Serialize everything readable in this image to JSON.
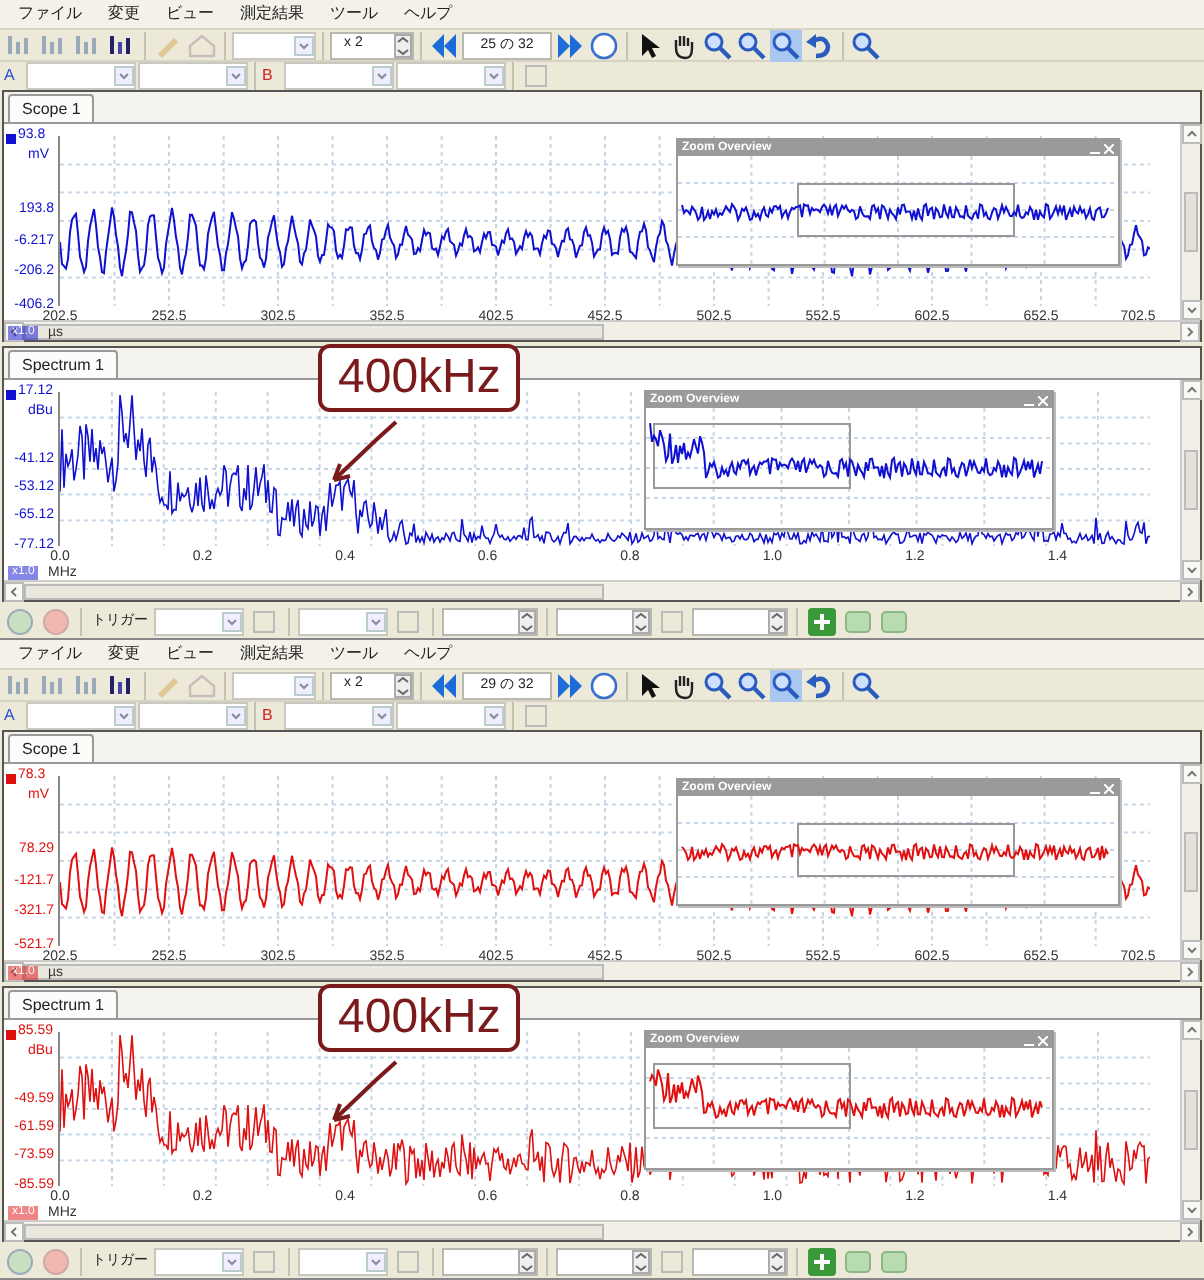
{
  "windows": [
    {
      "color": "#1010d0",
      "menu": [
        "ファイル",
        "変更",
        "ビュー",
        "測定結果",
        "ツール",
        "ヘルプ"
      ],
      "zoom_factor": "x 2",
      "page": "25 の 32",
      "channel_a": "A",
      "channel_b": "B",
      "scope": {
        "tab": "Scope 1",
        "y_labels": [
          "93.8",
          "193.8",
          "-6.217",
          "-206.2",
          "-406.2"
        ],
        "y_unit": "mV",
        "x_labels": [
          "202.5",
          "252.5",
          "302.5",
          "352.5",
          "402.5",
          "452.5",
          "502.5",
          "552.5",
          "602.5",
          "652.5",
          "702.5"
        ],
        "x_unit": "µs",
        "scale_badge": "x1.0",
        "overview_title": "Zoom Overview"
      },
      "spectrum": {
        "tab": "Spectrum 1",
        "y_labels": [
          "17.12",
          "-41.12",
          "-53.12",
          "-65.12",
          "-77.12"
        ],
        "y_unit": "dBu",
        "x_labels": [
          "0.0",
          "0.2",
          "0.4",
          "0.6",
          "0.8",
          "1.0",
          "1.2",
          "1.4"
        ],
        "x_unit": "MHz",
        "scale_badge": "x1.0",
        "overview_title": "Zoom Overview",
        "callout": "400kHz"
      },
      "trigger_label": "トリガー"
    },
    {
      "color": "#e01010",
      "menu": [
        "ファイル",
        "変更",
        "ビュー",
        "測定結果",
        "ツール",
        "ヘルプ"
      ],
      "zoom_factor": "x 2",
      "page": "29 の 32",
      "channel_a": "A",
      "channel_b": "B",
      "scope": {
        "tab": "Scope 1",
        "y_labels": [
          "78.3",
          "78.29",
          "-121.7",
          "-321.7",
          "-521.7"
        ],
        "y_unit": "mV",
        "x_labels": [
          "202.5",
          "252.5",
          "302.5",
          "352.5",
          "402.5",
          "452.5",
          "502.5",
          "552.5",
          "602.5",
          "652.5",
          "702.5"
        ],
        "x_unit": "µs",
        "scale_badge": "x1.0",
        "overview_title": "Zoom Overview"
      },
      "spectrum": {
        "tab": "Spectrum 1",
        "y_labels": [
          "85.59",
          "-49.59",
          "-61.59",
          "-73.59",
          "-85.59"
        ],
        "y_unit": "dBu",
        "x_labels": [
          "0.0",
          "0.2",
          "0.4",
          "0.6",
          "0.8",
          "1.0",
          "1.2",
          "1.4"
        ],
        "x_unit": "MHz",
        "scale_badge": "x1.0",
        "overview_title": "Zoom Overview",
        "callout": "400kHz"
      },
      "trigger_label": "トリガー"
    }
  ]
}
